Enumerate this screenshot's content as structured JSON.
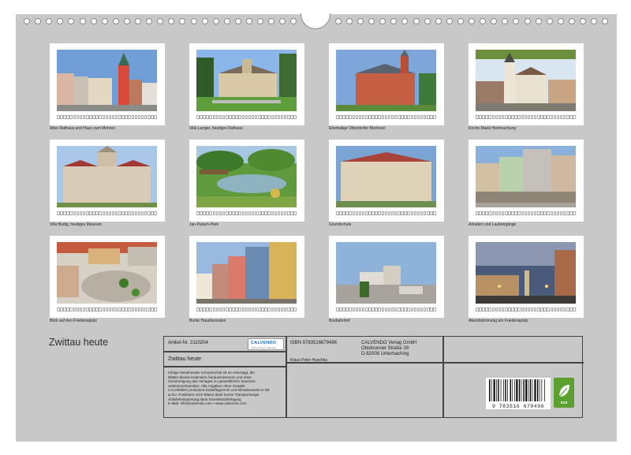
{
  "calendar_title": "Zwittau heute",
  "photos": [
    {
      "caption": "Altes Rathaus und Haus zum Mohren",
      "scene": "old-town-hall"
    },
    {
      "caption": "Villa Langer, heutiges Rathaus",
      "scene": "villa-langer"
    },
    {
      "caption": "Ehemalige Ottendorfer Bücherei",
      "scene": "library"
    },
    {
      "caption": "Kirche Mariä Heimsuchung",
      "scene": "church"
    },
    {
      "caption": "Villa Budig, heutiges Museum",
      "scene": "museum"
    },
    {
      "caption": "Jan-Palach-Park",
      "scene": "park"
    },
    {
      "caption": "Grundschule",
      "scene": "school"
    },
    {
      "caption": "Arkaden und Laubengänge",
      "scene": "arcades"
    },
    {
      "caption": "Blick auf den Friedensplatz",
      "scene": "square-aerial"
    },
    {
      "caption": "Bunte Hausfassaden",
      "scene": "facades"
    },
    {
      "caption": "Busbahnhof",
      "scene": "bus-station"
    },
    {
      "caption": "Abendstimmung am Friedensplatz",
      "scene": "evening"
    }
  ],
  "info": {
    "article_no": "Artikel-Nr. 2110204",
    "product_title": "Zwittau heute",
    "legal_text": "Infolge bestehender Schutzrechte ist es untersagt, die\nBlätter dieses Kalenders herauszutrennen und ohne\nGenehmigung des Verlages zu gewerblichen Zwecken\nweiterzuverwenden. Alle Angaben ohne Gewähr.\nCALVENDO produziert bedarfsgerecht und klimabewusst in DE\n& EU. Positivere CO2-Bilanz dank kurzer Transportwege.\nAbfall-Reduzierung dank Einzelstückfertigung.\nE-Mail: info@calvendo.com • www.calvendo.com",
    "isbn": "ISBN 9783516679496",
    "author": "Klaus-Peter Huschka",
    "publisher_name": "CALVENDO Verlag GmbH",
    "publisher_street": "Ottobrunner Straße 39",
    "publisher_city": "D-82008 Unterhaching",
    "logo_text": "CALVENDO",
    "logo_subtext": "A Bryce Photo Calendar",
    "barcode_number": "9 783516 679496",
    "eco_label": "eco",
    "eco_color": "#5aa12f"
  }
}
